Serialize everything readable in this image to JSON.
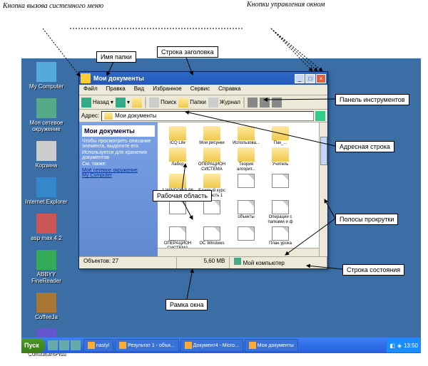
{
  "annotations": {
    "system_menu": "Кнопка\nвызова\nсистемного\nменю",
    "window_ctrl": "Кнопки\nуправления\nокном",
    "folder_name": "Имя папки",
    "titlebar": "Строка заголовка",
    "toolbar": "Панель инструментов",
    "addrbar": "Адресная строка",
    "workarea": "Рабочая область",
    "scrollbars": "Полосы прокрутки",
    "statusbar": "Строка состояния",
    "frame": "Рамка окна"
  },
  "desktop_icons": [
    "My Computer",
    "Моя сетевое окружение",
    "Корзина",
    "Internet Explorer",
    "asp max 4.2",
    "ABBYY FineReader",
    "CoffeeJa",
    "ConsultantPlus"
  ],
  "window": {
    "title": "Мои документы",
    "menus": [
      "Файл",
      "Правка",
      "Вид",
      "Избранное",
      "Сервис",
      "Справка"
    ],
    "toolbar": {
      "back": "Назад",
      "fwd": "",
      "up": "",
      "search": "Поиск",
      "folders": "Папки",
      "history": "Журнал"
    },
    "addr_label": "Адрес:",
    "addr_value": "Мои документы",
    "tasks_title": "Мои документы",
    "tasks_text1": "Чтобы просмотреть описание элемента, выделите его.",
    "tasks_text2": "Используется для хранения документов",
    "tasks_text3": "См. также:",
    "tasks_link1": "Моё сетевое окружение",
    "tasks_link2": "My Computer",
    "files": [
      {
        "n": "ICQ Lite",
        "t": "folder"
      },
      {
        "n": "Мои рисунки",
        "t": "folder"
      },
      {
        "n": "Использова...",
        "t": "folder"
      },
      {
        "n": "Пак_...",
        "t": "folder"
      },
      {
        "n": "Лабор",
        "t": "folder"
      },
      {
        "n": "ОПЕРАЦИОН СИСТЕМА",
        "t": "folder"
      },
      {
        "n": "Теория алгорит...",
        "t": "folder"
      },
      {
        "n": "Учитель",
        "t": "folder"
      },
      {
        "n": "1 WINDOWS 98 В ВОПР",
        "t": "folder"
      },
      {
        "n": "Базовый курс ПК Часть 1",
        "t": "folder"
      },
      {
        "n": "",
        "t": "file"
      },
      {
        "n": "",
        "t": "file"
      },
      {
        "n": "",
        "t": "file"
      },
      {
        "n": "",
        "t": "file"
      },
      {
        "n": "объекты",
        "t": "file"
      },
      {
        "n": "Операции с папками и ф",
        "t": "file"
      },
      {
        "n": "ОПЕРАЦИОН СИСТЕМА",
        "t": "file"
      },
      {
        "n": "ОС Windows",
        "t": "file"
      },
      {
        "n": "",
        "t": "file"
      },
      {
        "n": "План урока",
        "t": "file"
      },
      {
        "n": "",
        "t": "file"
      },
      {
        "n": "",
        "t": "file"
      },
      {
        "n": "",
        "t": "file"
      },
      {
        "n": "",
        "t": "file"
      },
      {
        "n": "",
        "t": "file"
      }
    ],
    "status": {
      "objects": "Объектов: 27",
      "size": "5,60 МВ",
      "location": "Мой компьютер"
    }
  },
  "taskbar": {
    "start": "Пуск",
    "tasks": [
      "nastyl",
      "Результат 1 - объя...",
      "Документ4 - Micro...",
      "Мои документы"
    ],
    "time": "13:50"
  }
}
